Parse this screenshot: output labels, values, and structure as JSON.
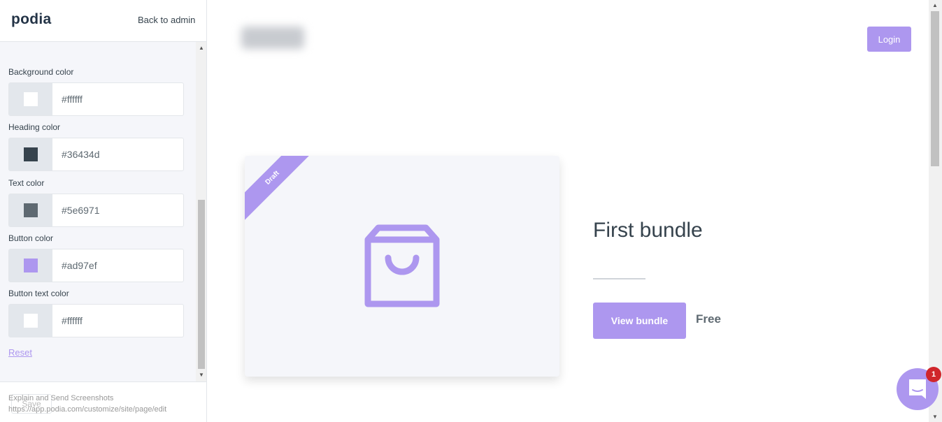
{
  "sidebar": {
    "logo": "podia",
    "back_link": "Back to admin",
    "fields": [
      {
        "label": "Background color",
        "value": "#ffffff",
        "swatch": "#ffffff"
      },
      {
        "label": "Heading color",
        "value": "#36434d",
        "swatch": "#36434d"
      },
      {
        "label": "Text color",
        "value": "#5e6971",
        "swatch": "#5e6971"
      },
      {
        "label": "Button color",
        "value": "#ad97ef",
        "swatch": "#ad97ef"
      },
      {
        "label": "Button text color",
        "value": "#ffffff",
        "swatch": "#ffffff"
      }
    ],
    "reset": "Reset",
    "save": "Save"
  },
  "overlay": {
    "line1": "Explain and Send Screenshots",
    "line2": "https://app.podia.com/customize/site/page/edit"
  },
  "preview": {
    "login": "Login",
    "ribbon": "Draft",
    "title": "First bundle",
    "view_button": "View bundle",
    "price": "Free"
  },
  "chat": {
    "badge": "1"
  },
  "colors": {
    "accent": "#ad97ef",
    "heading": "#36434d",
    "text": "#5e6971"
  }
}
